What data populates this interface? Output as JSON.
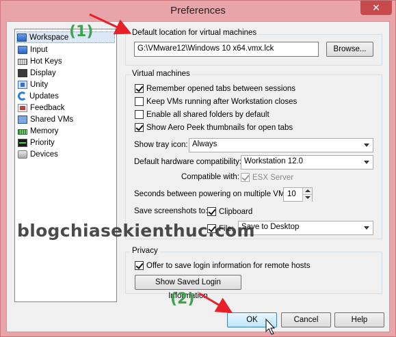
{
  "window": {
    "title": "Preferences",
    "close_glyph": "✕"
  },
  "nav": {
    "items": [
      {
        "label": "Workspace",
        "icon": "workspace-icon",
        "selected": true
      },
      {
        "label": "Input",
        "icon": "input-icon"
      },
      {
        "label": "Hot Keys",
        "icon": "hotkeys-icon"
      },
      {
        "label": "Display",
        "icon": "display-icon"
      },
      {
        "label": "Unity",
        "icon": "unity-icon"
      },
      {
        "label": "Updates",
        "icon": "updates-icon"
      },
      {
        "label": "Feedback",
        "icon": "feedback-icon"
      },
      {
        "label": "Shared VMs",
        "icon": "shared-vms-icon"
      },
      {
        "label": "Memory",
        "icon": "memory-icon"
      },
      {
        "label": "Priority",
        "icon": "priority-icon"
      },
      {
        "label": "Devices",
        "icon": "devices-icon"
      }
    ]
  },
  "default_location": {
    "label": "Default location for virtual machines",
    "value": "G:\\VMware12\\Windows 10 x64.vmx.lck",
    "browse_label": "Browse..."
  },
  "virtual_machines": {
    "label": "Virtual machines",
    "options": [
      {
        "label": "Remember opened tabs between sessions",
        "checked": true
      },
      {
        "label": "Keep VMs running after Workstation closes",
        "checked": false
      },
      {
        "label": "Enable all shared folders by default",
        "checked": false
      },
      {
        "label": "Show Aero Peek thumbnails for open tabs",
        "checked": true
      }
    ],
    "tray_icon": {
      "label": "Show tray icon:",
      "value": "Always"
    },
    "hw_compat": {
      "label": "Default hardware compatibility:",
      "value": "Workstation 12.0"
    },
    "compatible_with": {
      "label": "Compatible with:",
      "option_label": "ESX Server",
      "checked": true
    },
    "powering": {
      "label": "Seconds between powering on multiple VMs:",
      "value": "10"
    },
    "screenshots": {
      "label": "Save screenshots to:",
      "clipboard_label": "Clipboard",
      "clipboard_checked": true,
      "file_label": "File:",
      "file_checked": true,
      "file_value": "Save to Desktop"
    }
  },
  "privacy": {
    "label": "Privacy",
    "offer_label": "Offer to save login information for remote hosts",
    "offer_checked": true,
    "show_saved_label": "Show Saved Login Information"
  },
  "footer": {
    "ok_label": "OK",
    "cancel_label": "Cancel",
    "help_label": "Help"
  },
  "annotations": {
    "step1": "(1)",
    "step2": "(2)",
    "watermark": "blogchiasekienthuc.com"
  },
  "colors": {
    "title_bar": "#e9a4a9",
    "close_button": "#c74a4d",
    "annotation_green": "#3aa54a",
    "arrow_red": "#e8202a"
  }
}
